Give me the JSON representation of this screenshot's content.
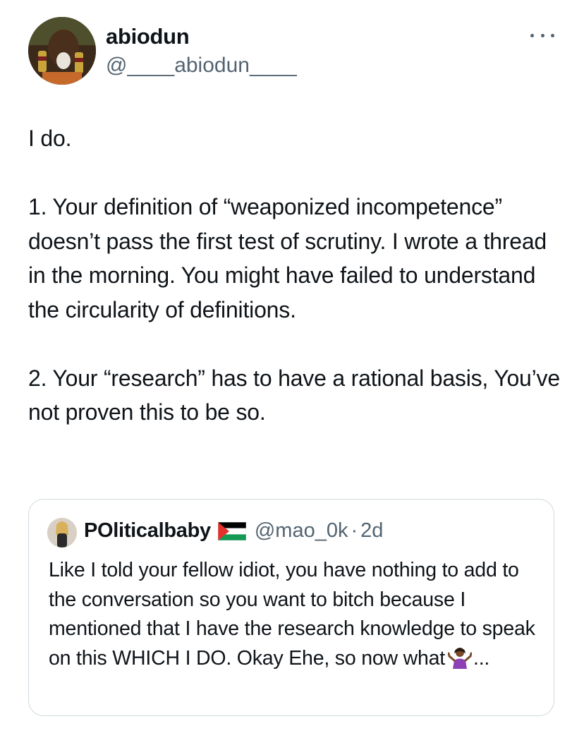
{
  "author": {
    "display_name": "abiodun",
    "handle": "@____abiodun____"
  },
  "tweet": {
    "text": "I do.\n\n1. Your definition of “weaponized incompetence” doesn’t pass the first test of scrutiny. I wrote a thread in the morning. You might have failed to understand the circularity of definitions.\n\n2. Your “research” has to have a rational basis, You’ve not proven this to be so."
  },
  "quoted_tweet": {
    "display_name": "POliticalbaby",
    "flag_icon": "palestine-flag-icon",
    "handle": "@mao_0k",
    "separator": "·",
    "time": "2d",
    "text_before_emoji": "Like I told your fellow idiot, you have nothing to add to the conversation so you want to bitch because I mentioned that I have the research knowledge to speak on this WHICH I DO. Okay Ehe, so now what",
    "emoji_icon": "person-shrugging-emoji",
    "text_after_emoji": "..."
  },
  "icons": {
    "more": "more-options-icon"
  },
  "colors": {
    "text": "#0f1419",
    "secondary": "#536471",
    "border": "#cfd9de",
    "flag_red": "#e4312b",
    "flag_green": "#149954"
  }
}
